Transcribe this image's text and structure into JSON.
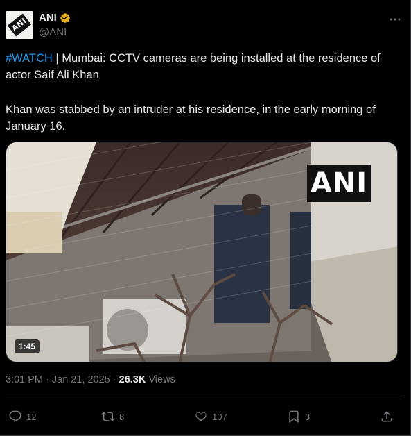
{
  "author": {
    "avatar_text": "ANI",
    "display_name": "ANI",
    "handle": "@ANI",
    "verified_color": "#e8b21e"
  },
  "more_icon": "more-horizontal-icon",
  "tweet": {
    "hashtag": "#WATCH",
    "line1_rest": " | Mumbai: CCTV cameras are being installed at the residence of actor Saif Ali Khan",
    "line2": "Khan was stabbed by an intruder at his residence, in the early morning of January 16."
  },
  "media": {
    "duration": "1:45",
    "watermark": "ANI"
  },
  "meta": {
    "timestamp": "3:01 PM · Jan 21, 2025",
    "separator": " · ",
    "views_count": "26.3K",
    "views_label": " Views"
  },
  "actions": {
    "replies": "12",
    "reposts": "8",
    "likes": "107",
    "bookmarks": "3"
  },
  "colors": {
    "background": "#000000",
    "text": "#e7e9ea",
    "muted": "#71767b",
    "link": "#1d9bf0",
    "border": "#2f3336"
  }
}
